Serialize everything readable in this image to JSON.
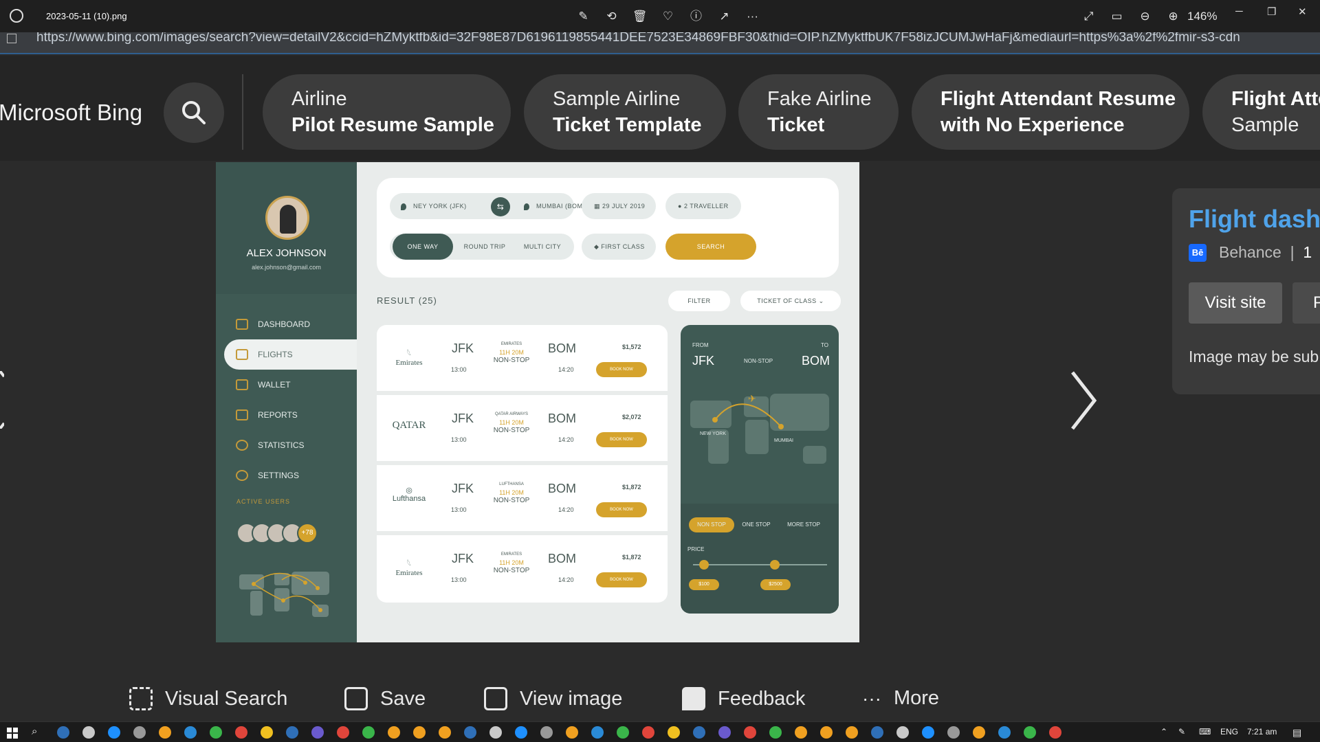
{
  "viewer": {
    "filename": "2023-05-11 (10).png",
    "zoom": "146%",
    "tools": [
      "edit-icon",
      "rotate-icon",
      "delete-icon",
      "heart-icon",
      "info-icon",
      "share-icon",
      "more-icon"
    ],
    "right_tools": [
      "expand-icon",
      "fit-icon",
      "zoom-out-icon",
      "zoom-in-icon"
    ]
  },
  "url": "https://www.bing.com/images/search?view=detailV2&ccid=hZMyktfb&id=32F98E87D6196119855441DEE7523E34869FBF30&thid=OIP.hZMyktfbUK7F58izJCUMJwHaFj&mediaurl=https%3a%2f%2fmir-s3-cdn",
  "bing": {
    "logo": "Microsoft Bing",
    "chips": [
      {
        "line1": "Airline",
        "line2": "Pilot Resume Sample"
      },
      {
        "line1": "Sample Airline",
        "line2": "Ticket Template"
      },
      {
        "line1": "Fake Airline",
        "line2": "Ticket"
      },
      {
        "line1": "Flight Attendant Resume",
        "line2": "with No Experience"
      },
      {
        "line1": "Flight Atte",
        "line2": "Sample"
      }
    ]
  },
  "dashboard": {
    "user": {
      "name": "ALEX JOHNSON",
      "email": "alex.johnson@gmail.com"
    },
    "nav": [
      "DASHBOARD",
      "FLIGHTS",
      "WALLET",
      "REPORTS",
      "STATISTICS",
      "SETTINGS"
    ],
    "active_users_label": "ACTIVE USERS",
    "active_users_more": "+78",
    "search": {
      "from": "NEY YORK (JFK)",
      "to": "MUMBAI (BOM)",
      "date": "29 JULY 2019",
      "travellers": "2 TRAVELLER",
      "trip_types": [
        "ONE WAY",
        "ROUND TRIP",
        "MULTI CITY"
      ],
      "class": "FIRST CLASS",
      "search_label": "SEARCH"
    },
    "result_label": "RESULT (25)",
    "filter_label": "FILTER",
    "ticket_class_label": "TICKET OF CLASS",
    "flights": [
      {
        "airline": "Emirates",
        "from": "JFK",
        "dep": "13:00",
        "carrier": "EMIRATES",
        "duration": "11H 20M",
        "stops": "NON-STOP",
        "to": "BOM",
        "arr": "14:20",
        "price": "$1,572",
        "book": "BOOK NOW"
      },
      {
        "airline": "QATAR",
        "from": "JFK",
        "dep": "13:00",
        "carrier": "QATAR AIRWAYS",
        "duration": "11H 20M",
        "stops": "NON-STOP",
        "to": "BOM",
        "arr": "14:20",
        "price": "$2,072",
        "book": "BOOK NOW"
      },
      {
        "airline": "Lufthansa",
        "from": "JFK",
        "dep": "13:00",
        "carrier": "LUFTHANSA",
        "duration": "11H 20M",
        "stops": "NON-STOP",
        "to": "BOM",
        "arr": "14:20",
        "price": "$1,872",
        "book": "BOOK NOW"
      },
      {
        "airline": "Emirates",
        "from": "JFK",
        "dep": "13:00",
        "carrier": "EMIRATES",
        "duration": "11H 20M",
        "stops": "NON-STOP",
        "to": "BOM",
        "arr": "14:20",
        "price": "$1,872",
        "book": "BOOK NOW"
      }
    ],
    "route": {
      "from_label": "FROM",
      "to_label": "TO",
      "from": "JFK",
      "to": "BOM",
      "stop": "NON-STOP",
      "city_from": "NEW YORK",
      "city_to": "MUMBAI",
      "stop_tabs": [
        "NON STOP",
        "ONE STOP",
        "MORE STOP"
      ],
      "price_label": "PRICE",
      "price_min": "$100",
      "price_max": "$2500"
    }
  },
  "info": {
    "title": "Flight dashb",
    "source": "Behance",
    "sep": "|",
    "extra": "1",
    "visit": "Visit site",
    "p": "P",
    "notice": "Image may be sub"
  },
  "actions": [
    {
      "label": "Visual Search",
      "icon": "visual-search-icon"
    },
    {
      "label": "Save",
      "icon": "save-icon"
    },
    {
      "label": "View image",
      "icon": "view-image-icon"
    },
    {
      "label": "Feedback",
      "icon": "feedback-icon"
    },
    {
      "label": "More",
      "icon": "more-icon"
    }
  ],
  "taskbar": {
    "lang": "ENG",
    "time": "7:21 am"
  },
  "colors": {
    "dash_green": "#3f5a54",
    "gold": "#d5a32c",
    "bing_link": "#4fa3ea"
  }
}
